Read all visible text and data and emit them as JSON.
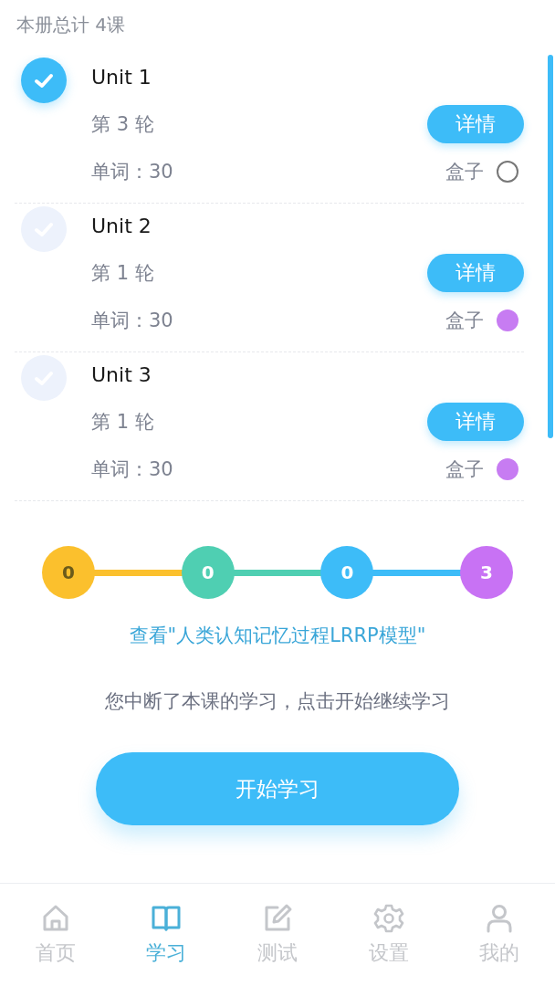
{
  "header": {
    "summary": "本册总计 4课"
  },
  "units": [
    {
      "title": "Unit 1",
      "checked": true,
      "round": "第 3 轮",
      "words": "单词：30",
      "details_button": "详情",
      "box_label": "盒子",
      "box_filled": false
    },
    {
      "title": "Unit 2",
      "checked": false,
      "round": "第 1 轮",
      "words": "单词：30",
      "details_button": "详情",
      "box_label": "盒子",
      "box_filled": true,
      "color": "#c77cf2"
    },
    {
      "title": "Unit 3",
      "checked": false,
      "round": "第 1 轮",
      "words": "单词：30",
      "details_button": "详情",
      "box_label": "盒子",
      "box_filled": true,
      "color": "#c77cf2"
    }
  ],
  "progress_steps": [
    {
      "value": "0",
      "color": "#fbc02d"
    },
    {
      "value": "0",
      "color": "#4fcfb2"
    },
    {
      "value": "0",
      "color": "#3dbcf8"
    },
    {
      "value": "3",
      "color": "#c872f4"
    }
  ],
  "model_link": "查看\"人类认知记忆过程LRRP模型\"",
  "resume_message": "您中断了本课的学习，点击开始继续学习",
  "start_button": "开始学习",
  "tab_bar": [
    {
      "label": "首页",
      "kind": "home",
      "selected": false
    },
    {
      "label": "学习",
      "kind": "book",
      "selected": true
    },
    {
      "label": "测试",
      "kind": "edit",
      "selected": false
    },
    {
      "label": "设置",
      "kind": "gear",
      "selected": false
    },
    {
      "label": "我的",
      "kind": "person",
      "selected": false
    }
  ]
}
